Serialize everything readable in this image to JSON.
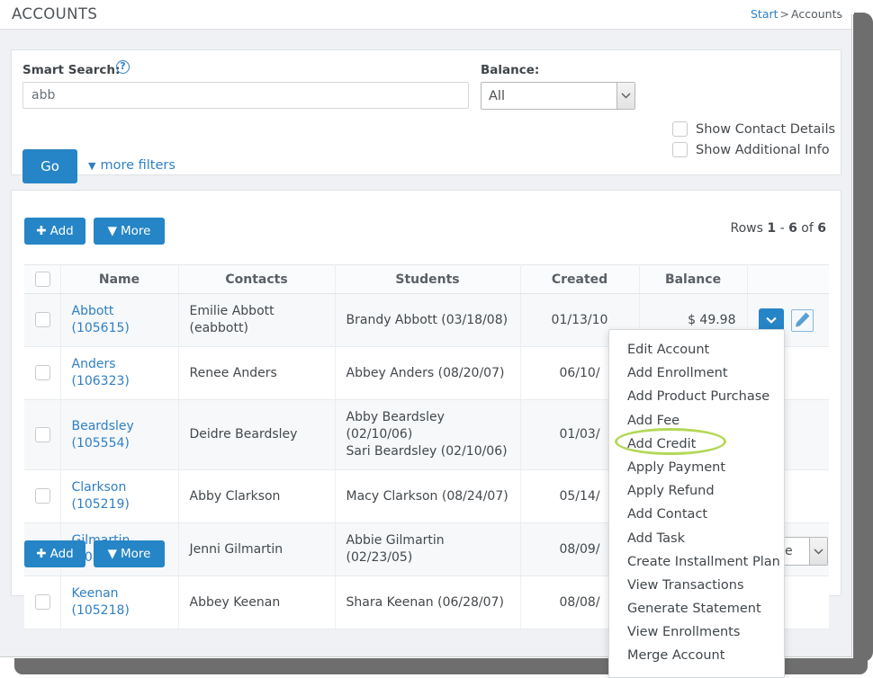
{
  "header": {
    "title": "ACCOUNTS",
    "breadcrumb": {
      "root": "Start",
      "separator": ">",
      "current": "Accounts"
    }
  },
  "filters": {
    "smart_search_label": "Smart Search:",
    "help_icon": "question-mark-circle-icon",
    "smart_search_value": "abb",
    "smart_search_placeholder": "",
    "balance_label": "Balance:",
    "balance_value": "All",
    "balance_options": [
      "All"
    ],
    "checkboxes": [
      {
        "label": "Show Contact Details",
        "checked": false
      },
      {
        "label": "Show Additional Info",
        "checked": false
      }
    ],
    "go_label": "Go",
    "more_filters_label": "more filters",
    "more_filters_icon": "chevron-down-icon"
  },
  "results": {
    "add_label": "Add",
    "add_icon": "plus-icon",
    "more_label": "More",
    "more_icon": "chevron-down-icon",
    "rows_info": {
      "prefix": "Rows",
      "from": "1",
      "dash": "-",
      "to": "6",
      "of": "of",
      "total": "6"
    },
    "page_size_value": "e",
    "columns": [
      "",
      "Name",
      "Contacts",
      "Students",
      "Created",
      "Balance",
      ""
    ],
    "rows": [
      {
        "name": "Abbott (105615)",
        "contacts": "Emilie Abbott (eabbott)",
        "students": "Brandy Abbott (03/18/08)",
        "created": "01/13/10",
        "balance": "$ 49.98"
      },
      {
        "name": "Anders (106323)",
        "contacts": "Renee Anders",
        "students": "Abbey Anders (08/20/07)",
        "created": "06/10/",
        "balance": ""
      },
      {
        "name": "Beardsley (105554)",
        "contacts": "Deidre Beardsley",
        "students": "Abby Beardsley (02/10/06)\nSari Beardsley (02/10/06)",
        "created": "01/03/",
        "balance": ""
      },
      {
        "name": "Clarkson (105219)",
        "contacts": "Abby Clarkson",
        "students": "Macy Clarkson (08/24/07)",
        "created": "05/14/",
        "balance": ""
      },
      {
        "name": "Gilmartin (105818)",
        "contacts": "Jenni Gilmartin",
        "students": "Abbie Gilmartin (02/23/05)",
        "created": "08/09/",
        "balance": ""
      },
      {
        "name": "Keenan (105218)",
        "contacts": "Abbey Keenan",
        "students": "Shara Keenan (06/28/07)",
        "created": "08/08/",
        "balance": ""
      }
    ]
  },
  "context_menu": {
    "items": [
      "Edit Account",
      "Add Enrollment",
      "Add Product Purchase",
      "Add Fee",
      "Add Credit",
      "Apply Payment",
      "Apply Refund",
      "Add Contact",
      "Add Task",
      "Create Installment Plan",
      "View Transactions",
      "Generate Statement",
      "View Enrollments",
      "Merge Account"
    ],
    "highlighted_item": "Add Credit"
  },
  "colors": {
    "primary_blue": "#2585c6",
    "link_blue": "#2f7fc4",
    "highlight_green": "#b4d858",
    "body_bg": "#eff1f4"
  }
}
